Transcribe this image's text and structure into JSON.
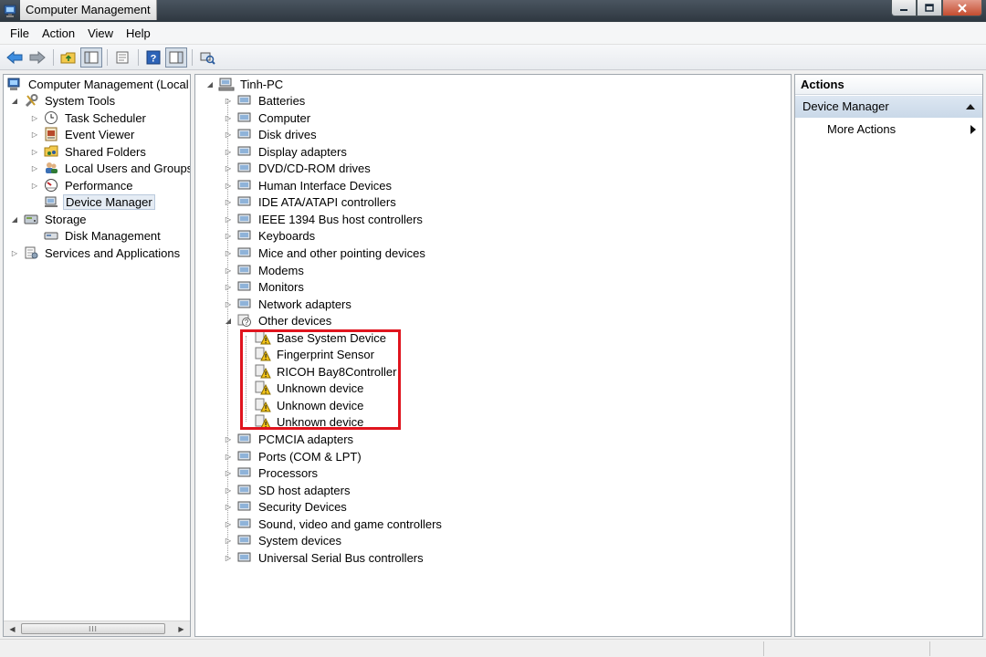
{
  "window": {
    "title": "Computer Management"
  },
  "menu": [
    "File",
    "Action",
    "View",
    "Help"
  ],
  "toolbar": {
    "buttons": [
      "back-arrow-icon",
      "forward-arrow-icon",
      "up-folder-icon",
      "show-hide-console-tree-icon",
      "properties-icon",
      "help-icon",
      "show-hide-action-pane-icon",
      "scan-hardware-icon"
    ]
  },
  "left_tree": {
    "root": "Computer Management (Local",
    "system_tools": "System Tools",
    "task_scheduler": "Task Scheduler",
    "event_viewer": "Event Viewer",
    "shared_folders": "Shared Folders",
    "local_users_groups": "Local Users and Groups",
    "performance": "Performance",
    "device_manager": "Device Manager",
    "storage": "Storage",
    "disk_management": "Disk Management",
    "services_apps": "Services and Applications"
  },
  "device_tree": {
    "computer_name": "Tinh-PC",
    "categories": [
      "Batteries",
      "Computer",
      "Disk drives",
      "Display adapters",
      "DVD/CD-ROM drives",
      "Human Interface Devices",
      "IDE ATA/ATAPI controllers",
      "IEEE 1394 Bus host controllers",
      "Keyboards",
      "Mice and other pointing devices",
      "Modems",
      "Monitors",
      "Network adapters",
      "Other devices"
    ],
    "other_devices": [
      "Base System Device",
      "Fingerprint Sensor",
      "RICOH Bay8Controller",
      "Unknown device",
      "Unknown device",
      "Unknown device"
    ],
    "categories_after": [
      "PCMCIA adapters",
      "Ports (COM & LPT)",
      "Processors",
      "SD host adapters",
      "Security Devices",
      "Sound, video and game controllers",
      "System devices",
      "Universal Serial Bus controllers"
    ]
  },
  "actions": {
    "header": "Actions",
    "section": "Device Manager",
    "more_actions": "More Actions"
  },
  "colors": {
    "highlight_box": "#e0141e",
    "selection": "#e5ecf4",
    "actions_section": "#c9d8e8"
  },
  "scrollbar": {
    "thumb_grip": "III"
  }
}
